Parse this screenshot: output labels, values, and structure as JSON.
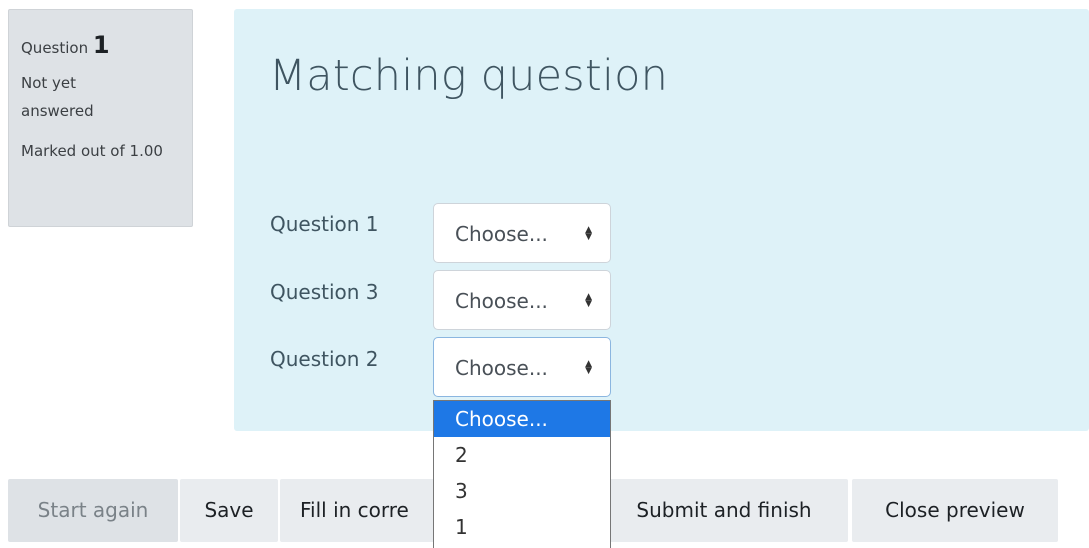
{
  "info": {
    "question_label": "Question",
    "question_number": "1",
    "state": "Not yet answered",
    "grade": "Marked out of 1.00"
  },
  "question": {
    "title": "Matching question",
    "rows": [
      {
        "label": "Question 1",
        "selected": "Choose..."
      },
      {
        "label": "Question 3",
        "selected": "Choose..."
      },
      {
        "label": "Question 2",
        "selected": "Choose..."
      }
    ],
    "dropdown_options": [
      "Choose...",
      "2",
      "3",
      "1"
    ],
    "caret_icon": "sort-caret-icon"
  },
  "buttons": {
    "start_again": "Start again",
    "save": "Save",
    "fill_in": "Fill in corre",
    "submit": "Submit and finish",
    "close_preview": "Close preview"
  },
  "colors": {
    "panel_bg": "#def2f8",
    "info_bg": "#dee2e6",
    "selected_option": "#1e78e6"
  }
}
